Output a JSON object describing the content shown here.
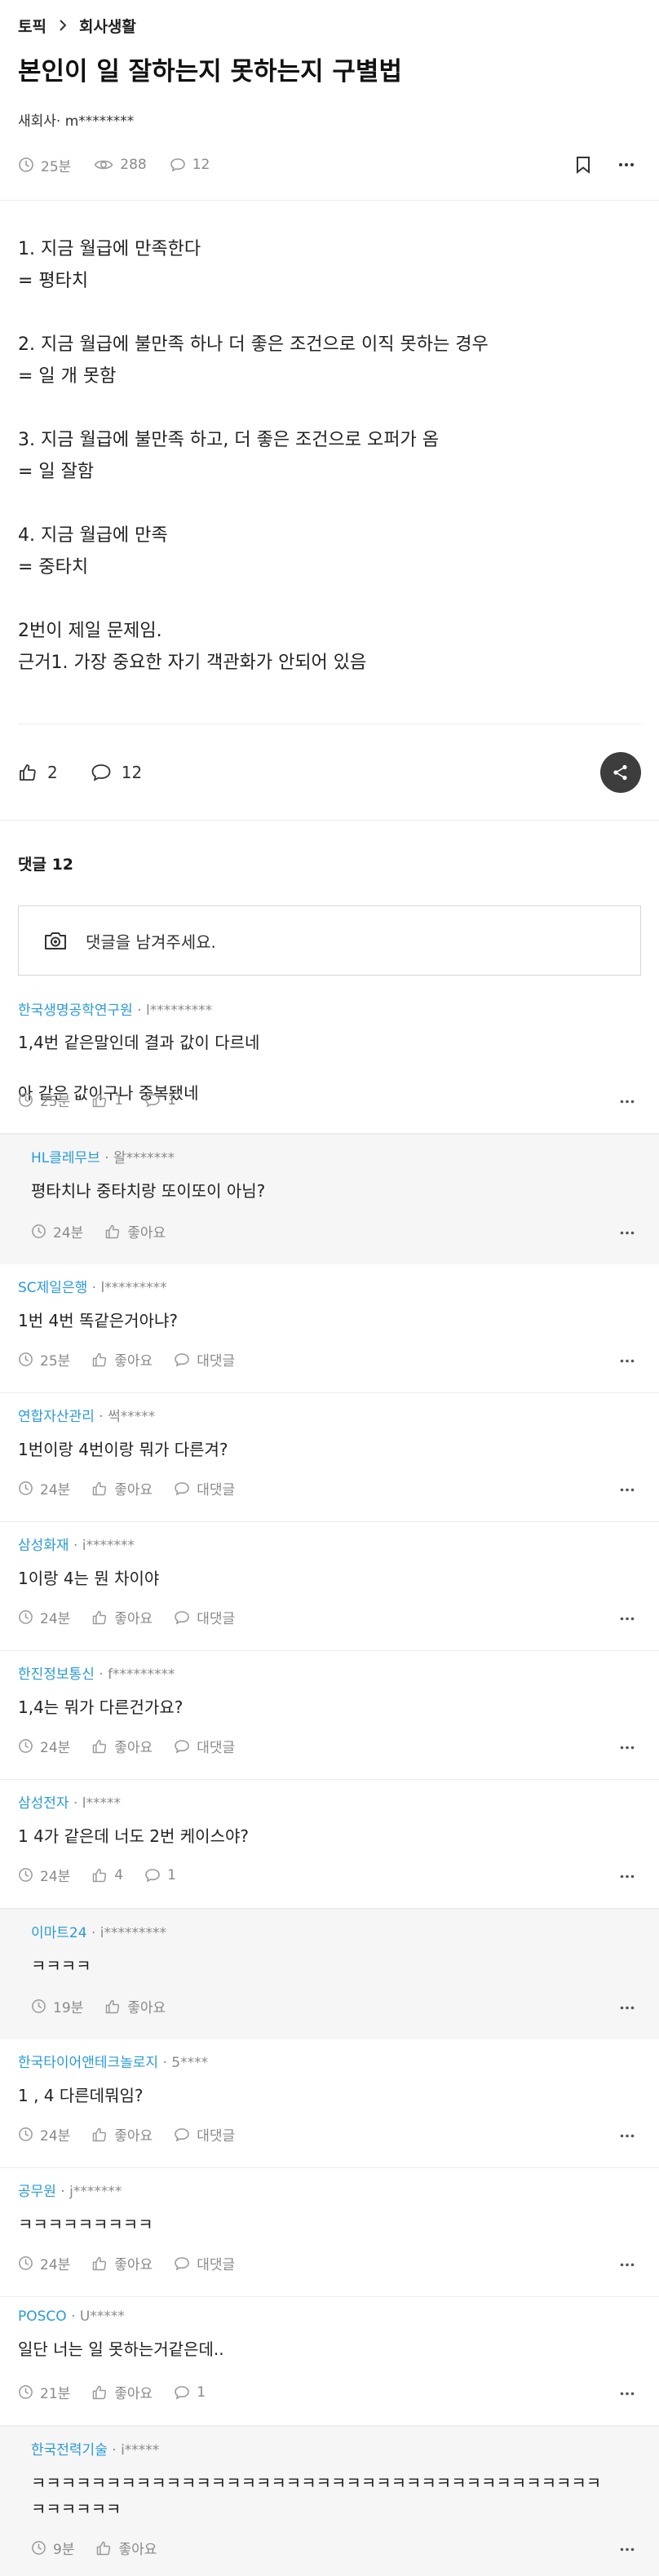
{
  "breadcrumb": {
    "category": "토픽",
    "board": "회사생활"
  },
  "post": {
    "title": "본인이 일 잘하는지 못하는지 구별법",
    "author": "새회사· m********",
    "time": "25분",
    "views": "288",
    "comments": "12",
    "body": [
      [
        "1. 지금 월급에 만족한다",
        "= 평타치"
      ],
      [
        "2. 지금 월급에 불만족 하나 더 좋은 조건으로 이직 못하는 경우",
        "= 일 개 못함"
      ],
      [
        "3. 지금 월급에 불만족 하고, 더 좋은 조건으로 오퍼가 옴",
        "= 일 잘함"
      ],
      [
        "4. 지금 월급에 만족",
        "= 중타치"
      ],
      [
        "2번이 제일 문제임.",
        "근거1. 가장 중요한 자기 객관화가 안되어 있음"
      ]
    ],
    "likes": "2",
    "comment_count": "12"
  },
  "comments_section": {
    "heading": "댓글 12",
    "input_placeholder": "댓글을 남겨주세요."
  },
  "comments": [
    {
      "company": "한국생명공학연구원",
      "user": "l*********",
      "lines": [
        "1,4번 같은말인데 결과 값이 다르네",
        "",
        "아 같은 값이구나 중복됐네"
      ],
      "time": "25분",
      "likes": "1",
      "replies": "1",
      "reply": false
    },
    {
      "company": "HL클레무브",
      "user": "왈*******",
      "lines": [
        "평타치나 중타치랑 또이또이 아님?"
      ],
      "time": "24분",
      "likes": "좋아요",
      "replies": null,
      "reply": true
    },
    {
      "company": "SC제일은행",
      "user": "l*********",
      "lines": [
        "1번 4번 똑같은거아냐?"
      ],
      "time": "25분",
      "likes": "좋아요",
      "replies": "대댓글",
      "reply": false
    },
    {
      "company": "연합자산관리",
      "user": "썩*****",
      "lines": [
        "1번이랑 4번이랑 뭐가 다른겨?"
      ],
      "time": "24분",
      "likes": "좋아요",
      "replies": "대댓글",
      "reply": false
    },
    {
      "company": "삼성화재",
      "user": "i*******",
      "lines": [
        "1이랑 4는 뭔 차이야"
      ],
      "time": "24분",
      "likes": "좋아요",
      "replies": "대댓글",
      "reply": false
    },
    {
      "company": "한진정보통신",
      "user": "f*********",
      "lines": [
        "1,4는 뭐가 다른건가요?"
      ],
      "time": "24분",
      "likes": "좋아요",
      "replies": "대댓글",
      "reply": false
    },
    {
      "company": "삼성전자",
      "user": "l*****",
      "lines": [
        "1 4가 같은데 너도 2번 케이스야?"
      ],
      "time": "24분",
      "likes": "4",
      "replies": "1",
      "reply": false
    },
    {
      "company": "이마트24",
      "user": "i*********",
      "lines": [
        "ㅋㅋㅋㅋ"
      ],
      "time": "19분",
      "likes": "좋아요",
      "replies": null,
      "reply": true
    },
    {
      "company": "한국타이어앤테크놀로지",
      "user": "5****",
      "lines": [
        "1 , 4 다른데뭐임?"
      ],
      "time": "24분",
      "likes": "좋아요",
      "replies": "대댓글",
      "reply": false
    },
    {
      "company": "공무원",
      "user": "j*******",
      "lines": [
        "ㅋㅋㅋㅋㅋㅋㅋㅋㅋ"
      ],
      "time": "24분",
      "likes": "좋아요",
      "replies": "대댓글",
      "reply": false
    },
    {
      "company": "POSCO",
      "user": "U*****",
      "lines": [
        "일단 너는 일 못하는거같은데.."
      ],
      "time": "21분",
      "likes": "좋아요",
      "replies": "1",
      "reply": false
    },
    {
      "company": "한국전력기술",
      "user": "i*****",
      "lines": [
        "ㅋㅋㅋㅋㅋㅋㅋㅋㅋㅋㅋㅋㅋㅋㅋㅋㅋㅋㅋㅋㅋㅋㅋㅋㅋㅋㅋㅋㅋㅋㅋㅋㅋㅋㅋㅋㅋㅋ",
        "ㅋㅋㅋㅋㅋㅋ"
      ],
      "time": "9분",
      "likes": "좋아요",
      "replies": null,
      "reply": true
    }
  ],
  "colors": {
    "company": "#2a9ad6",
    "meta": "#8a8a8a",
    "reply_bg": "#f6f6f6",
    "share_bg": "#3d3d3d"
  },
  "icons": [
    "chevron-right-icon",
    "clock-icon",
    "eye-icon",
    "comment-icon",
    "bookmark-icon",
    "more-icon",
    "thumbs-up-icon",
    "share-icon",
    "camera-icon"
  ]
}
